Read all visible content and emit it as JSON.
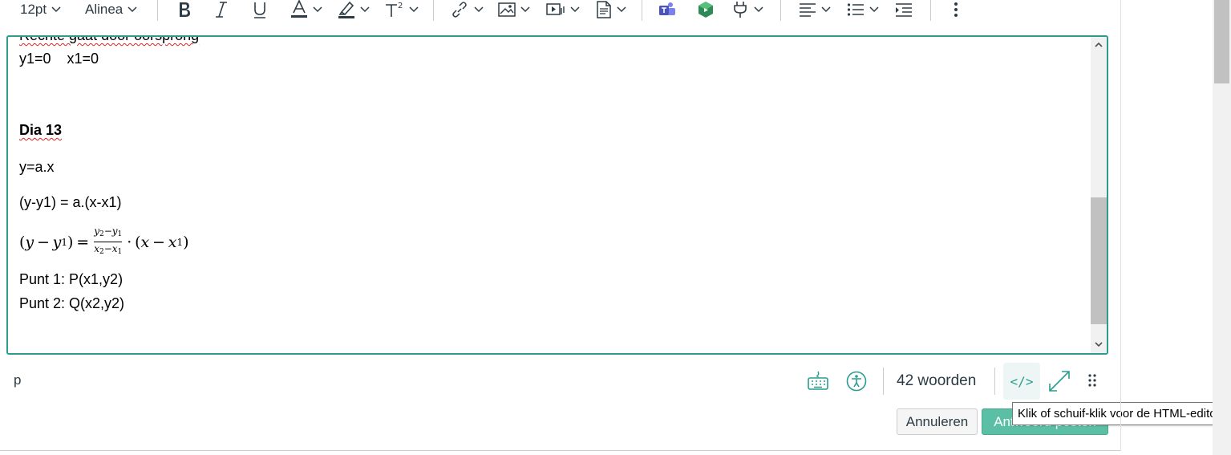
{
  "toolbar": {
    "font_size": "12pt",
    "block_format": "Alinea"
  },
  "editor": {
    "lines": {
      "cut_top": "Rechte gaat door oorsprong",
      "coords": "y1=0    x1=0",
      "heading": "Dia 13",
      "eq1": "y=a.x",
      "eq2": "(y-y1) = a.(x-x1)",
      "punt1": "Punt 1: P(x1,y2)",
      "punt2": "Punt 2: Q(x2,y2)"
    }
  },
  "statusbar": {
    "path": "p",
    "word_count": "42 woorden",
    "html_label": "</>"
  },
  "actions": {
    "cancel": "Annuleren",
    "post": "Antwoord posten"
  },
  "tooltip": "Klik of schuif-klik voor de HTML-editor.",
  "colors": {
    "accent": "#2a9d8f",
    "post_button": "#5bbfa6",
    "text": "#2d3b45"
  }
}
